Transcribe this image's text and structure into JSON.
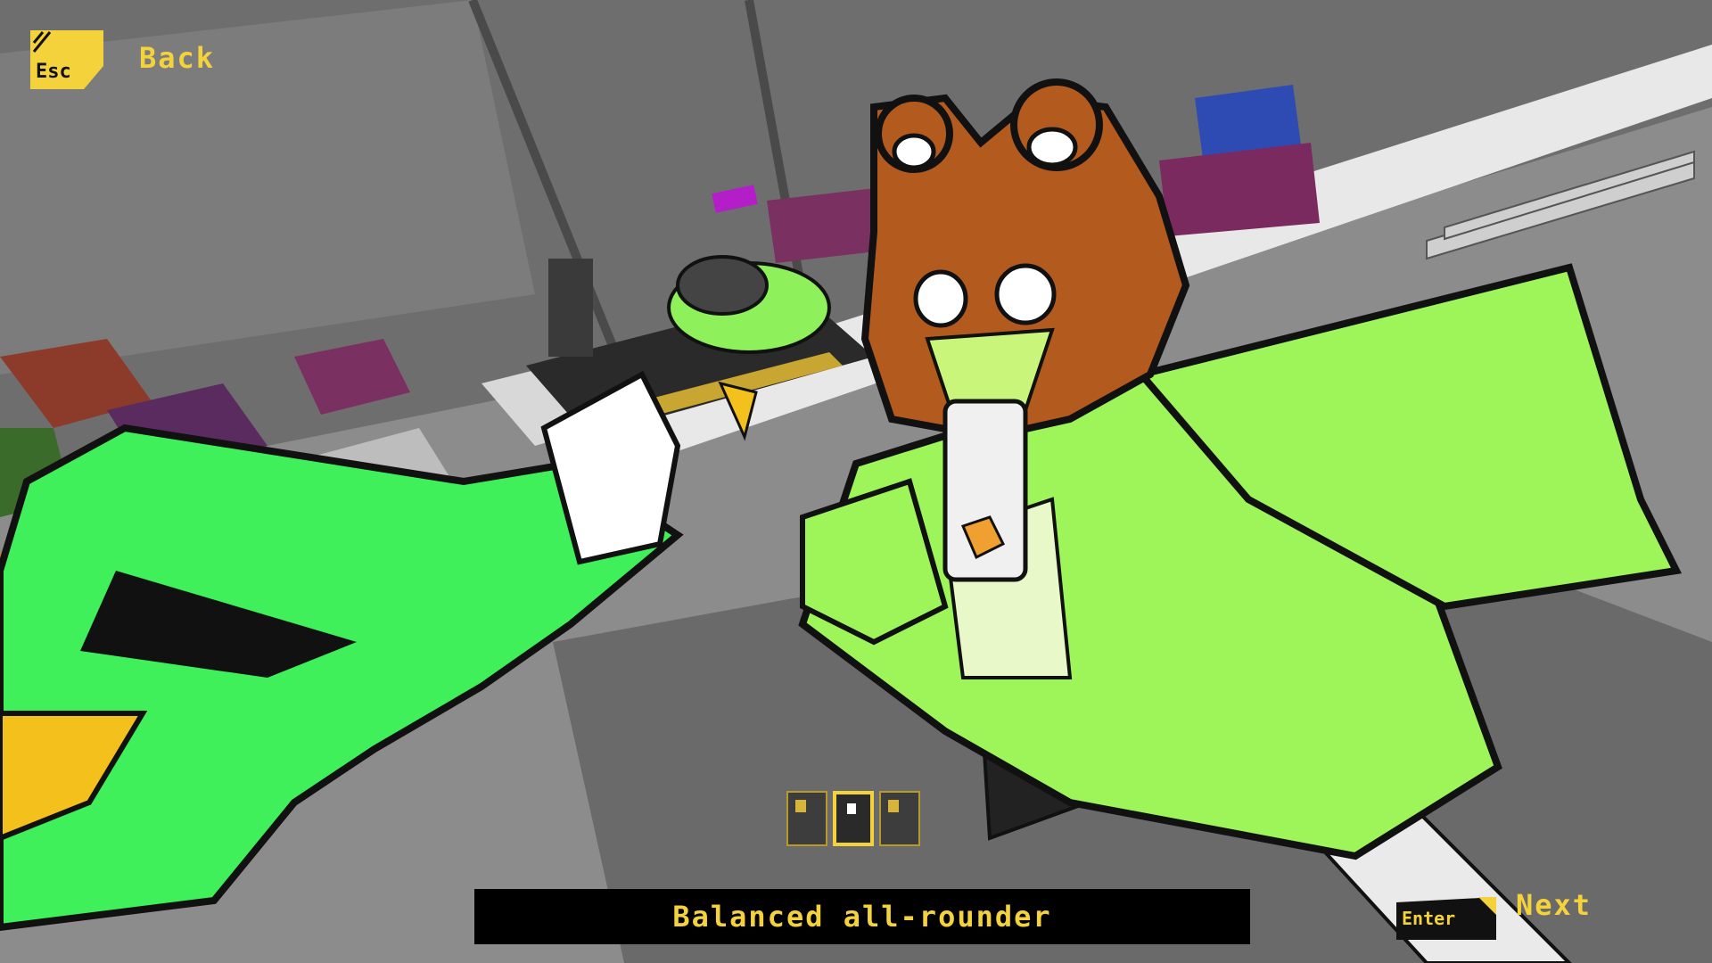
{
  "hud": {
    "back_key": "Esc",
    "back_label": "Back",
    "next_key": "Enter",
    "next_label": "Next",
    "description": "Balanced all-rounder"
  },
  "selector": {
    "count": 3,
    "selected_index": 1
  },
  "colors": {
    "accent": "#f4d23c",
    "character_green": "#9ef55a",
    "bright_green": "#3ff05a",
    "hood_brown": "#b35a1e",
    "floor_gray": "#8a8a8a"
  }
}
